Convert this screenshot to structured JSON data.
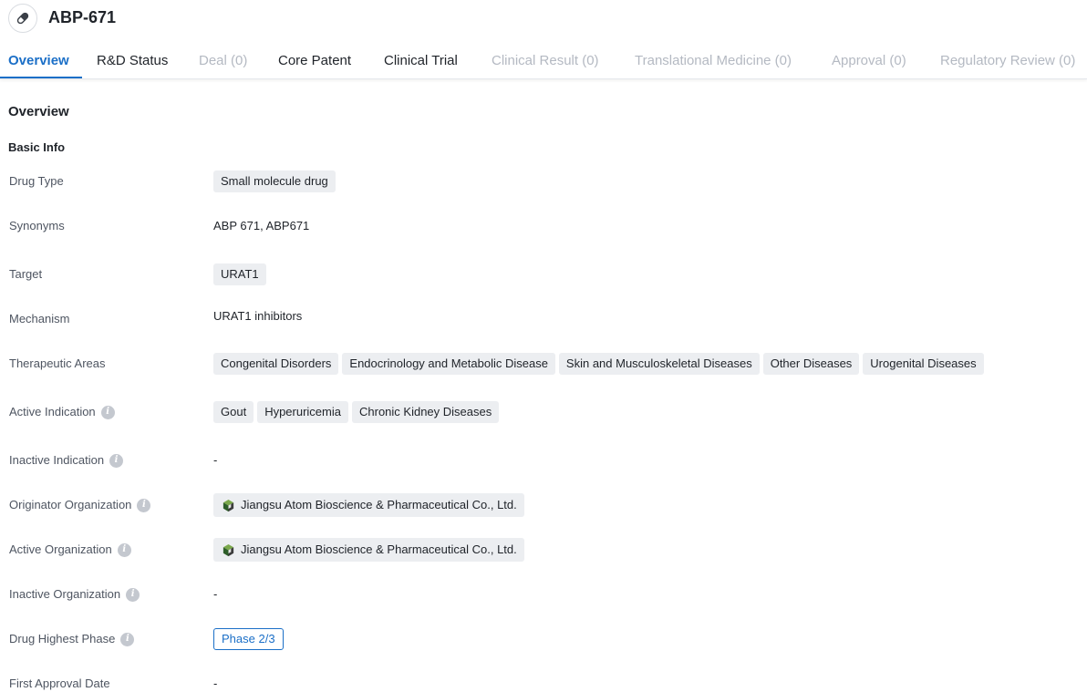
{
  "header": {
    "drug_icon": "pill-icon",
    "title": "ABP-671"
  },
  "tabs": [
    {
      "label": "Overview",
      "state": "active"
    },
    {
      "label": "R&D Status",
      "state": "enabled"
    },
    {
      "label": "Deal (0)",
      "state": "disabled"
    },
    {
      "label": "Core Patent",
      "state": "enabled"
    },
    {
      "label": "Clinical Trial",
      "state": "enabled"
    },
    {
      "label": "Clinical Result (0)",
      "state": "disabled"
    },
    {
      "label": "Translational Medicine (0)",
      "state": "disabled"
    },
    {
      "label": "Approval (0)",
      "state": "disabled"
    },
    {
      "label": "Regulatory Review (0)",
      "state": "disabled"
    }
  ],
  "overview": {
    "title": "Overview",
    "basic_info_title": "Basic Info",
    "rows": {
      "drug_type": {
        "label": "Drug Type",
        "tags": [
          "Small molecule drug"
        ]
      },
      "synonyms": {
        "label": "Synonyms",
        "value": "ABP 671,  ABP671"
      },
      "target": {
        "label": "Target",
        "tags": [
          "URAT1"
        ]
      },
      "mechanism": {
        "label": "Mechanism",
        "value": "URAT1 inhibitors"
      },
      "therapeutic_areas": {
        "label": "Therapeutic Areas",
        "tags": [
          "Congenital Disorders",
          "Endocrinology and Metabolic Disease",
          "Skin and Musculoskeletal Diseases",
          "Other Diseases",
          "Urogenital Diseases"
        ]
      },
      "active_indication": {
        "label": "Active Indication",
        "tags": [
          "Gout",
          "Hyperuricemia",
          "Chronic Kidney Diseases"
        ]
      },
      "inactive_indication": {
        "label": "Inactive Indication",
        "value": "-"
      },
      "originator_org": {
        "label": "Originator Organization",
        "org": "Jiangsu Atom Bioscience & Pharmaceutical Co., Ltd."
      },
      "active_org": {
        "label": "Active Organization",
        "org": "Jiangsu Atom Bioscience & Pharmaceutical Co., Ltd."
      },
      "inactive_org": {
        "label": "Inactive Organization",
        "value": "-"
      },
      "highest_phase": {
        "label": "Drug Highest Phase",
        "phase": "Phase 2/3"
      },
      "first_approval": {
        "label": "First Approval Date",
        "value": "-"
      }
    }
  },
  "colors": {
    "accent": "#1b6fc7",
    "tag_bg": "#eceef1",
    "disabled_text": "#b4b9c2"
  }
}
